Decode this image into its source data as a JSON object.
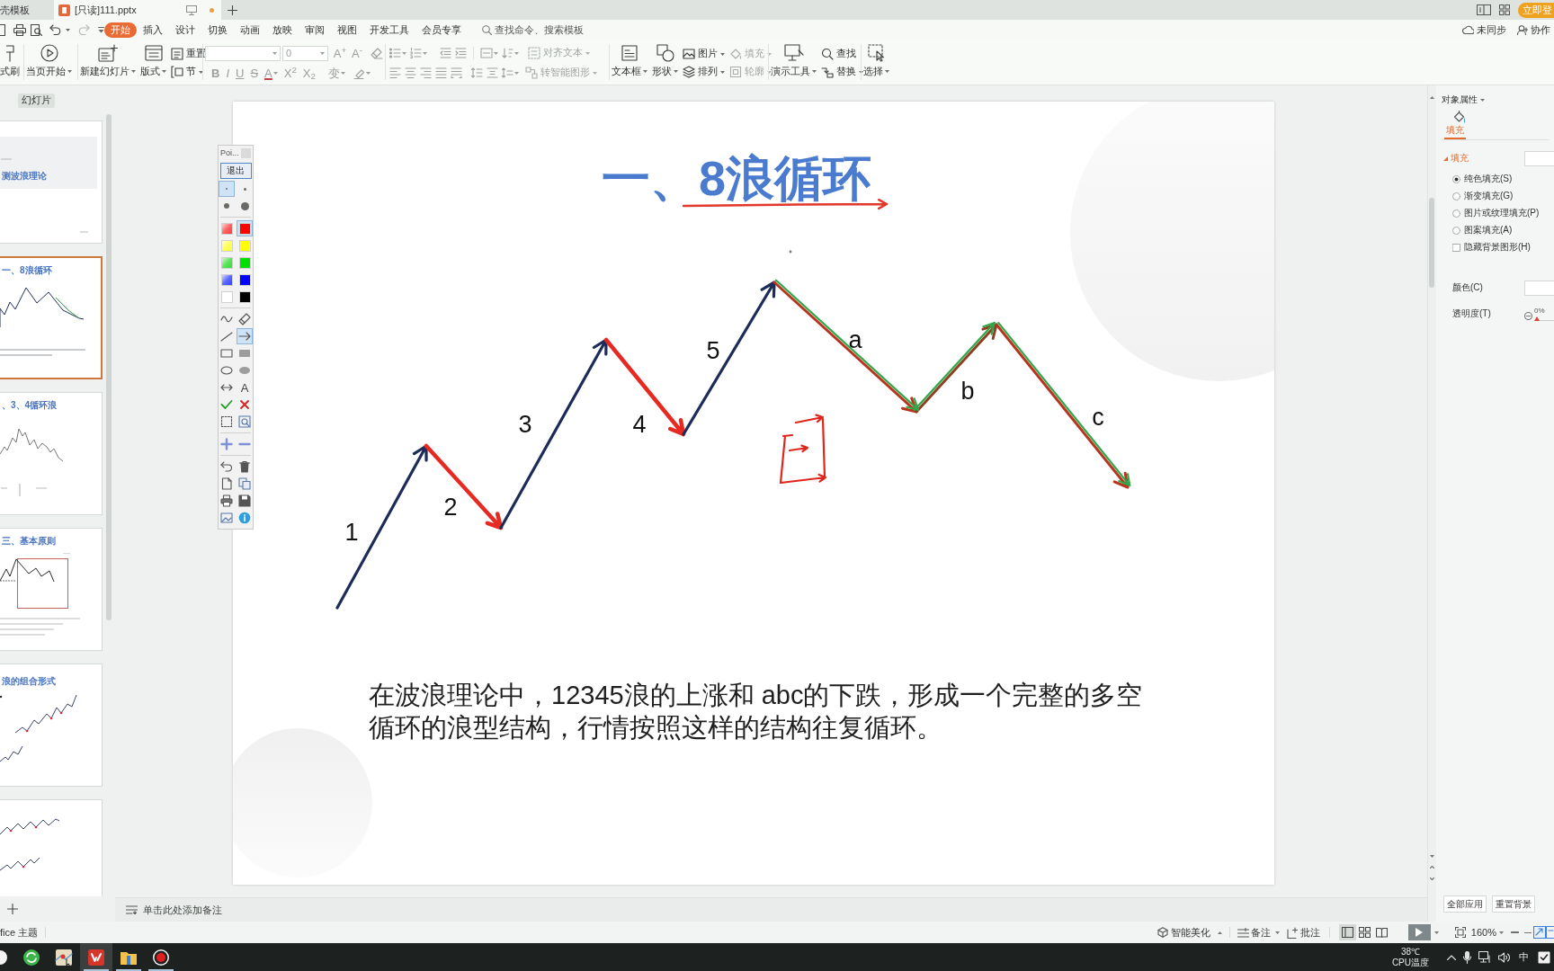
{
  "tabs": [
    {
      "label": "壳模板",
      "selected": false,
      "modified": false
    },
    {
      "label": "[只读]111.pptx",
      "selected": true,
      "modified": true
    }
  ],
  "account": {
    "login_button": "立即登"
  },
  "menu": {
    "items": [
      {
        "label": "开始",
        "selected": true
      },
      {
        "label": "插入",
        "selected": false
      },
      {
        "label": "设计",
        "selected": false
      },
      {
        "label": "切换",
        "selected": false
      },
      {
        "label": "动画",
        "selected": false
      },
      {
        "label": "放映",
        "selected": false
      },
      {
        "label": "审阅",
        "selected": false
      },
      {
        "label": "视图",
        "selected": false
      },
      {
        "label": "开发工具",
        "selected": false
      },
      {
        "label": "会员专享",
        "selected": false
      }
    ],
    "search": {
      "placeholder": "查找命令、搜索模板"
    },
    "sync": "未同步",
    "collaborate": "协作"
  },
  "ribbon": {
    "groups": [
      {
        "kind": "buttons",
        "buttons": [
          {
            "kind": "large",
            "label": "式刷",
            "dropdown": false,
            "disabled": false
          }
        ]
      },
      {
        "kind": "buttons",
        "buttons": [
          {
            "kind": "large",
            "label": "当页开始",
            "dropdown": true,
            "disabled": false
          }
        ]
      },
      {
        "kind": "buttons",
        "buttons": [
          {
            "kind": "large",
            "label": "新建幻灯片",
            "dropdown": true,
            "disabled": false
          },
          {
            "kind": "large",
            "label": "版式",
            "dropdown": true,
            "disabled": false
          },
          {
            "kind": "small",
            "label": "重置",
            "dropdown": false,
            "disabled": false
          },
          {
            "kind": "small",
            "label": "节",
            "dropdown": true,
            "disabled": false
          }
        ]
      },
      {
        "kind": "font",
        "font_size": {
          "value": "0"
        },
        "buttons": [
          {
            "label": "A$^{+}$",
            "disabled": true
          },
          {
            "label": "A$^{-}$",
            "disabled": true
          },
          {
            "label": "B",
            "disabled": true
          },
          {
            "label": "I",
            "disabled": true
          },
          {
            "label": "U",
            "disabled": true
          },
          {
            "label": "S",
            "disabled": true
          },
          {
            "label": "A",
            "disabled": true
          },
          {
            "label": "X$^{2}$",
            "disabled": true
          },
          {
            "label": "X$_{2}$",
            "disabled": true
          },
          {
            "label": "变",
            "disabled": true
          }
        ]
      },
      {
        "kind": "paragraph",
        "buttons": [
          {
            "kind": "small",
            "label": "对齐文本",
            "dropdown": true,
            "disabled": true
          },
          {
            "kind": "small",
            "label": "转智能图形",
            "dropdown": true,
            "disabled": true
          }
        ]
      },
      {
        "kind": "buttons",
        "buttons": [
          {
            "kind": "large",
            "label": "文本框",
            "dropdown": true,
            "disabled": false
          },
          {
            "kind": "large",
            "label": "形状",
            "dropdown": true,
            "disabled": false
          },
          {
            "kind": "small",
            "label": "图片",
            "dropdown": true,
            "disabled": false
          },
          {
            "kind": "small",
            "label": "排列",
            "dropdown": true,
            "disabled": false
          },
          {
            "kind": "small",
            "label": "填充",
            "dropdown": true,
            "disabled": true
          },
          {
            "kind": "small",
            "label": "轮廓",
            "dropdown": true,
            "disabled": true
          }
        ]
      },
      {
        "kind": "buttons",
        "buttons": [
          {
            "kind": "large",
            "label": "演示工具",
            "dropdown": true,
            "disabled": false
          },
          {
            "kind": "small",
            "label": "查找",
            "dropdown": false,
            "disabled": false
          },
          {
            "kind": "small",
            "label": "替换",
            "dropdown": true,
            "disabled": false
          }
        ]
      },
      {
        "kind": "buttons",
        "buttons": [
          {
            "kind": "large",
            "label": "选择",
            "dropdown": true,
            "disabled": false
          }
        ]
      }
    ]
  },
  "slides_panel": {
    "tabs": [
      {
        "label": "幻灯片",
        "selected": true
      }
    ],
    "slides": [
      {
        "title": "测波浪理论",
        "selected": false
      },
      {
        "title": "一、8浪循环",
        "selected": true
      },
      {
        "title": "、3、4循环浪",
        "selected": false
      },
      {
        "title": "三、基本原则",
        "selected": false
      },
      {
        "title": "浪的组合形式",
        "selected": false
      },
      {
        "selected": false
      }
    ]
  },
  "pointer_toolbar": {
    "title": "Poi...",
    "exit_button": "退出",
    "pen_sizes": [
      {
        "selected": true
      },
      {
        "selected": false
      },
      {
        "selected": false
      },
      {
        "selected": false
      }
    ],
    "colors": [
      {
        "kind": "gradient",
        "color": "#ff3b3b",
        "selected": false
      },
      {
        "kind": "solid",
        "color": "#ff0000",
        "selected": true
      },
      {
        "kind": "gradient",
        "color": "#ffff33",
        "selected": false
      },
      {
        "kind": "solid",
        "color": "#ffff00",
        "selected": false
      },
      {
        "kind": "gradient",
        "color": "#33dd33",
        "selected": false
      },
      {
        "kind": "solid",
        "color": "#00e000",
        "selected": false
      },
      {
        "kind": "gradient",
        "color": "#3344ff",
        "selected": false
      },
      {
        "kind": "solid",
        "color": "#0000ff",
        "selected": false
      },
      {
        "kind": "solid",
        "color": "#ffffff",
        "selected": false
      },
      {
        "kind": "solid",
        "color": "#000000",
        "selected": false
      }
    ],
    "tools": [
      {
        "selected": false
      },
      {
        "selected": false
      },
      {
        "selected": false
      },
      {
        "selected": true
      },
      {
        "selected": false
      },
      {
        "selected": false
      },
      {
        "selected": false
      },
      {
        "selected": false
      },
      {
        "selected": false
      },
      {
        "label": "A",
        "selected": false
      },
      {
        "selected": false
      },
      {
        "selected": false
      },
      {
        "selected": false
      },
      {
        "selected": false
      }
    ]
  },
  "slide": {
    "title": "一、8浪循环",
    "wave_labels": [
      "1",
      "2",
      "3",
      "4",
      "5",
      "a",
      "b",
      "c"
    ],
    "text": "在波浪理论中，12345浪的上涨和 abc的下跌，形成一个完整的多空循环的浪型结构，行情按照这样的结构往复循环。"
  },
  "notes": {
    "placeholder": "单击此处添加备注"
  },
  "properties_panel": {
    "title": "对象属性",
    "tabs": [
      {
        "label": "填充",
        "selected": true
      }
    ],
    "section": {
      "label": "填充",
      "expanded": true
    },
    "fill_options": [
      {
        "label": "纯色填充(S)",
        "selected": true
      },
      {
        "label": "渐变填充(G)",
        "selected": false
      },
      {
        "label": "图片或纹理填充(P)",
        "selected": false
      },
      {
        "label": "图案填充(A)",
        "selected": false
      }
    ],
    "hide_background": {
      "label": "隐藏背景图形(H)",
      "checked": false
    },
    "color_label": "颜色(C)",
    "transparency": {
      "label": "透明度(T)",
      "reading": "0%",
      "level": 0
    },
    "buttons": [
      "全部应用",
      "重置背景"
    ]
  },
  "status_bar": {
    "theme": "fice 主题",
    "beautify": "智能美化",
    "notes": "备注",
    "comments": "批注",
    "views": [
      {
        "selected": true
      },
      {
        "selected": false
      },
      {
        "selected": false
      }
    ],
    "zoom": "160%"
  },
  "taskbar": {
    "apps": [
      {
        "selected": false,
        "running": false
      },
      {
        "selected": false,
        "running": false
      },
      {
        "selected": false,
        "running": false
      },
      {
        "selected": true,
        "running": true
      },
      {
        "selected": false,
        "running": true
      },
      {
        "selected": false,
        "running": true
      }
    ],
    "cpu_temperature": "38℃",
    "cpu_label": "CPU温度",
    "input_method": "中"
  }
}
